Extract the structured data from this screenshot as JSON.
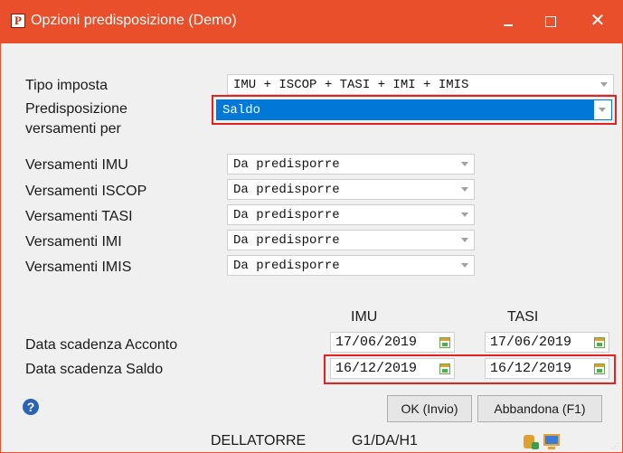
{
  "window": {
    "title": "Opzioni predisposizione  (Demo)",
    "app_icon_letter": "P",
    "minimize_glyph": "",
    "close_glyph": "✕"
  },
  "form": {
    "tipo_imposta": {
      "label": "Tipo imposta",
      "value": "IMU + ISCOP + TASI + IMI + IMIS"
    },
    "predisposizione": {
      "label_line1": "Predisposizione",
      "label_line2": "versamenti per",
      "value": "Saldo"
    },
    "versamenti": [
      {
        "label": "Versamenti IMU",
        "value": "Da predisporre"
      },
      {
        "label": "Versamenti ISCOP",
        "value": "Da predisporre"
      },
      {
        "label": "Versamenti TASI",
        "value": "Da predisporre"
      },
      {
        "label": "Versamenti IMI",
        "value": "Da predisporre"
      },
      {
        "label": "Versamenti IMIS",
        "value": "Da predisporre"
      }
    ]
  },
  "dates": {
    "col_imu": "IMU",
    "col_tasi": "TASI",
    "acconto": {
      "label": "Data scadenza Acconto",
      "imu": "17/06/2019",
      "tasi": "17/06/2019"
    },
    "saldo": {
      "label": "Data scadenza Saldo",
      "imu": "16/12/2019",
      "tasi": "16/12/2019"
    }
  },
  "buttons": {
    "ok": "OK (Invio)",
    "abbandona": "Abbandona (F1)",
    "help_glyph": "?"
  },
  "status": {
    "user": "DELLATORRE",
    "code": "G1/DA/H1"
  },
  "colors": {
    "titlebar": "#e84f2a",
    "selection": "#0078d7",
    "highlight": "#e32222"
  }
}
